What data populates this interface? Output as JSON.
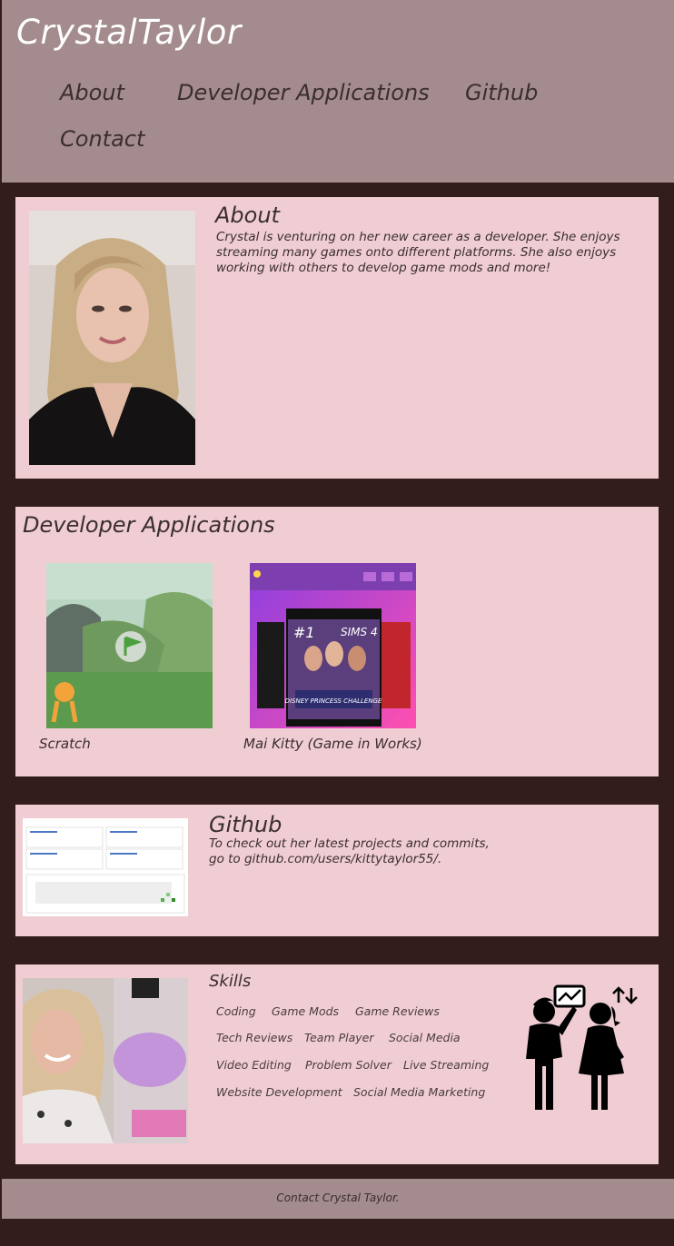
{
  "header": {
    "brand": "CrystalTaylor",
    "nav": [
      "About",
      "Developer Applications",
      "Github",
      "Contact"
    ]
  },
  "about": {
    "title": "About",
    "text": "Crystal is venturing on her new career as a developer. She enjoys streaming many games onto different platforms. She also enjoys working with others to develop game mods and more!"
  },
  "apps": {
    "title": "Developer Applications",
    "items": [
      {
        "caption": "Scratch"
      },
      {
        "caption": "Mai Kitty (Game in Works)",
        "thumb_badge": "#1",
        "thumb_text": "DISNEY PRINCESS CHALLENGE",
        "thumb_sims": "SIMS 4"
      }
    ]
  },
  "github": {
    "title": "Github",
    "text": "To check out her latest projects and commits, go to github.com/users/kittytaylor55/."
  },
  "skills": {
    "title": "Skills",
    "list": [
      "Coding",
      "Game Mods",
      "Game Reviews",
      "Tech Reviews",
      "Team Player",
      "Social Media",
      "Video Editing",
      "Problem Solver",
      "Live Streaming",
      "Website Development",
      "Social Media Marketing"
    ]
  },
  "footer": {
    "text": "Contact Crystal Taylor."
  },
  "colors": {
    "background": "#331c1c",
    "header": "#a48b8d",
    "card": "#efcdd3"
  }
}
